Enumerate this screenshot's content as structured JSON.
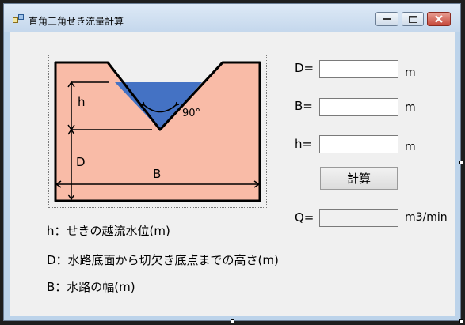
{
  "window": {
    "title": "直角三角せき流量計算"
  },
  "diagram": {
    "label_h": "h",
    "label_d": "D",
    "label_b": "B",
    "angle": "90°",
    "colors": {
      "wall": "#f9bba7",
      "water": "#4472c4",
      "outline": "#000000"
    }
  },
  "form": {
    "d_label": "D=",
    "d_unit": "m",
    "b_label": "B=",
    "b_unit": "m",
    "h_label": "h=",
    "h_unit": "m",
    "calc_button": "計算",
    "q_label": "Q=",
    "q_unit": "m3/min"
  },
  "descriptions": {
    "h": "h：せきの越流水位(m)",
    "d": "D：水路底面から切欠き底点までの高さ(m)",
    "b": "B：水路の幅(m)"
  }
}
